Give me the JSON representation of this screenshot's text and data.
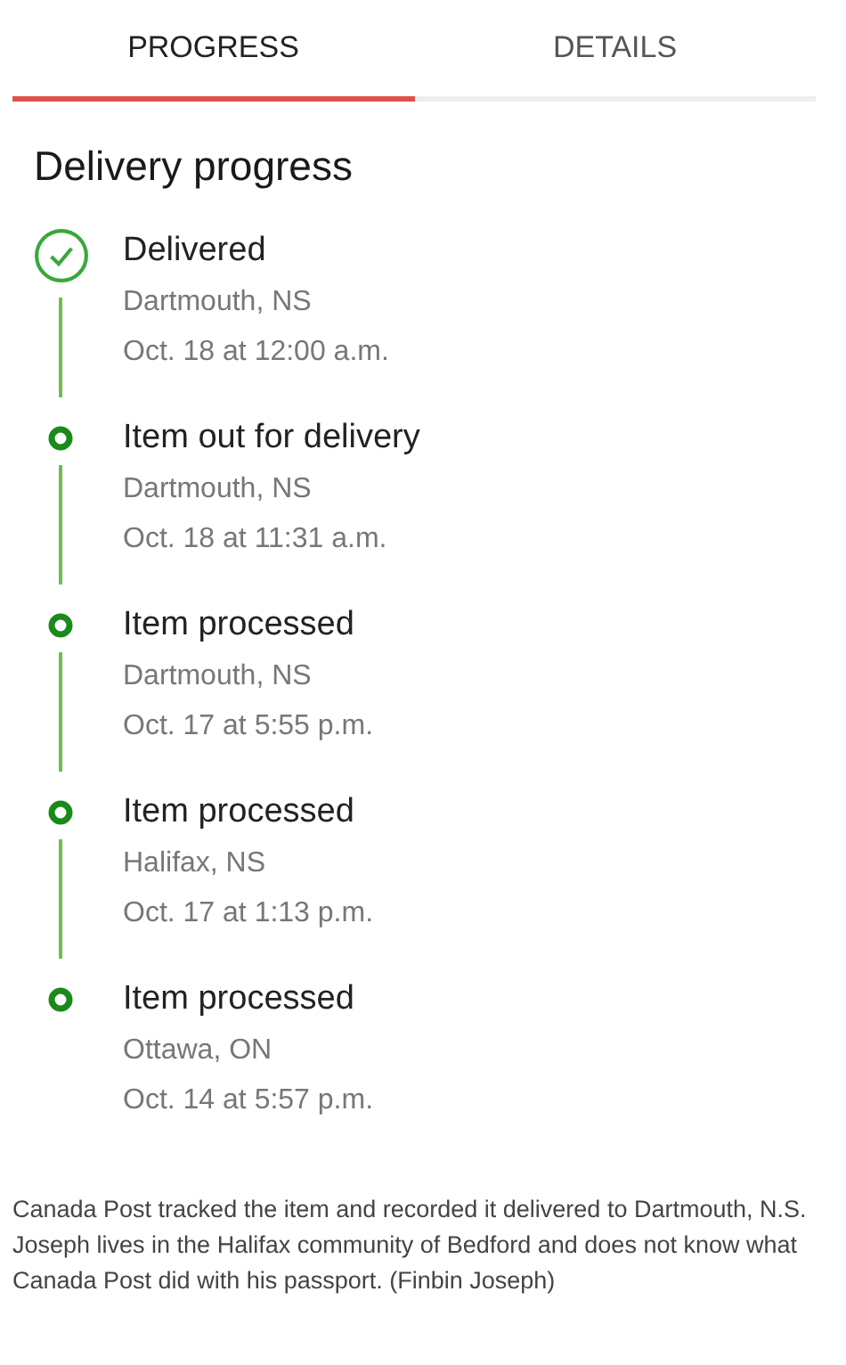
{
  "tabs": [
    {
      "label": "PROGRESS",
      "selected": true
    },
    {
      "label": "DETAILS",
      "selected": false
    }
  ],
  "heading": "Delivery progress",
  "events": [
    {
      "kind": "delivered",
      "title": "Delivered",
      "location": "Dartmouth, NS",
      "time": "Oct. 18 at 12:00 a.m."
    },
    {
      "kind": "step",
      "title": "Item out for delivery",
      "location": "Dartmouth, NS",
      "time": "Oct. 18 at 11:31 a.m."
    },
    {
      "kind": "step",
      "title": "Item processed",
      "location": "Dartmouth, NS",
      "time": "Oct. 17 at 5:55 p.m."
    },
    {
      "kind": "step",
      "title": "Item processed",
      "location": "Halifax, NS",
      "time": "Oct. 17 at 1:13 p.m."
    },
    {
      "kind": "step",
      "title": "Item processed",
      "location": "Ottawa, ON",
      "time": "Oct. 14 at 5:57 p.m."
    }
  ],
  "caption": "Canada Post tracked the item and recorded it delivered to Dartmouth, N.S. Joseph lives in the Halifax community of Bedford and does not know what Canada Post did with his passport. (Finbin Joseph)"
}
